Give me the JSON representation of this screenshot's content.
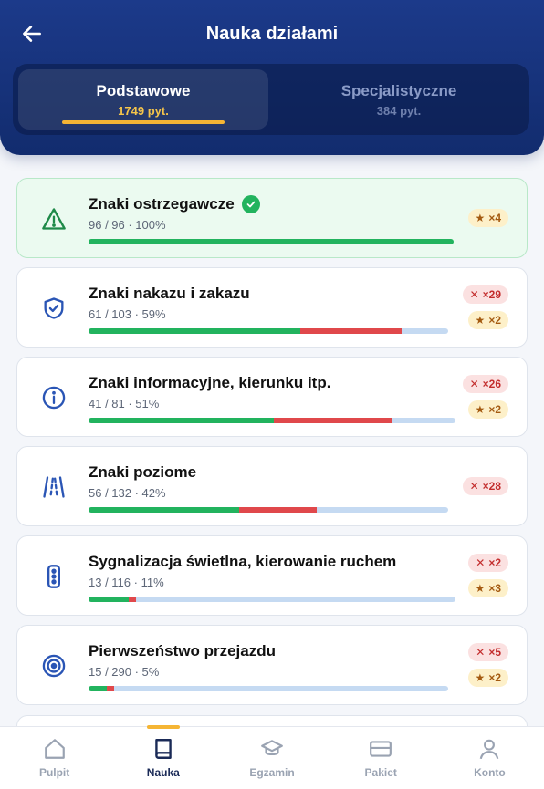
{
  "header": {
    "title": "Nauka działami",
    "tabs": [
      {
        "name": "Podstawowe",
        "count": "1749 pyt."
      },
      {
        "name": "Specjalistyczne",
        "count": "384 pyt."
      }
    ]
  },
  "sections": [
    {
      "title": "Znaki ostrzegawcze",
      "stats": "96 / 96 · 100%",
      "icon": "warning-triangle-icon",
      "correct": 1.0,
      "wrong": 0.0,
      "errors": "",
      "stars": "×4"
    },
    {
      "title": "Znaki nakazu i zakazu",
      "stats": "61 / 103 · 59%",
      "icon": "shield-check-icon",
      "correct": 0.59,
      "wrong": 0.28,
      "errors": "×29",
      "stars": "×2"
    },
    {
      "title": "Znaki informacyjne, kierunku itp.",
      "stats": "41 / 81 · 51%",
      "icon": "info-circle-icon",
      "correct": 0.505,
      "wrong": 0.32,
      "errors": "×26",
      "stars": "×2"
    },
    {
      "title": "Znaki poziome",
      "stats": "56 / 132 · 42%",
      "icon": "road-lines-icon",
      "correct": 0.42,
      "wrong": 0.215,
      "errors": "×28",
      "stars": ""
    },
    {
      "title": "Sygnalizacja świetlna, kierowanie ruchem",
      "stats": "13 / 116 · 11%",
      "icon": "traffic-light-icon",
      "correct": 0.11,
      "wrong": 0.02,
      "errors": "×2",
      "stars": "×3"
    },
    {
      "title": "Pierwszeństwo przejazdu",
      "stats": "15 / 290 · 5%",
      "icon": "target-icon",
      "correct": 0.052,
      "wrong": 0.02,
      "errors": "×5",
      "stars": "×2"
    }
  ],
  "nav": [
    {
      "label": "Pulpit",
      "icon": "home-icon"
    },
    {
      "label": "Nauka",
      "icon": "book-icon"
    },
    {
      "label": "Egzamin",
      "icon": "graduation-cap-icon"
    },
    {
      "label": "Pakiet",
      "icon": "card-icon"
    },
    {
      "label": "Konto",
      "icon": "user-icon"
    }
  ],
  "colors": {
    "accent": "#f5b534",
    "correct": "#22b35e",
    "wrong": "#e0484b",
    "remaining": "#c5daf2",
    "header": "#1c3a8a"
  }
}
